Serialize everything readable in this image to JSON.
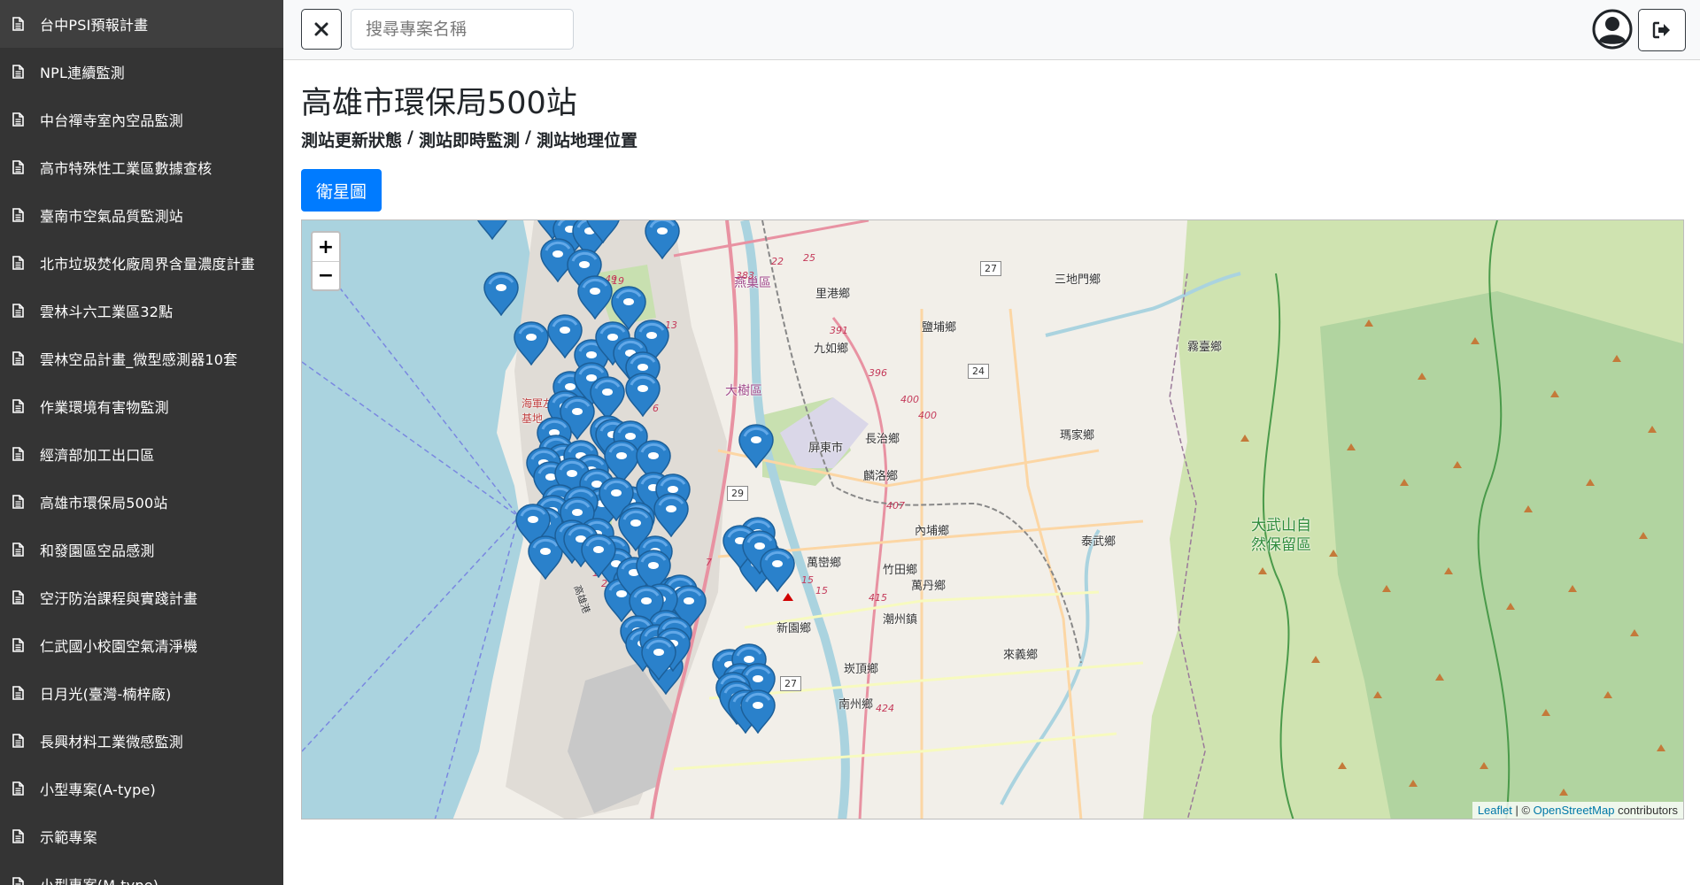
{
  "sidebar": {
    "items": [
      {
        "label": "台中PSI預報計畫"
      },
      {
        "label": "NPL連續監測"
      },
      {
        "label": "中台禪寺室內空品監測"
      },
      {
        "label": "高市特殊性工業區數據查核"
      },
      {
        "label": "臺南市空氣品質監測站"
      },
      {
        "label": "北市垃圾焚化廠周界含量濃度計畫"
      },
      {
        "label": "雲林斗六工業區32點"
      },
      {
        "label": "雲林空品計畫_微型感測器10套"
      },
      {
        "label": "作業環境有害物監測"
      },
      {
        "label": "經濟部加工出口區"
      },
      {
        "label": "高雄市環保局500站"
      },
      {
        "label": "和發園區空品感測"
      },
      {
        "label": "空汙防治課程與實踐計畫"
      },
      {
        "label": "仁武國小校園空氣清淨機"
      },
      {
        "label": "日月光(臺灣-楠梓廠)"
      },
      {
        "label": "長興材料工業微感監測"
      },
      {
        "label": "小型專案(A-type)"
      },
      {
        "label": "示範專案"
      },
      {
        "label": "小型專案(M-type)"
      }
    ]
  },
  "topbar": {
    "search_placeholder": "搜尋專案名稱",
    "close_icon": "times-icon",
    "user_icon": "user-circle-icon",
    "logout_icon": "sign-out-icon"
  },
  "main": {
    "title": "高雄市環保局500站",
    "breadcrumbs": [
      "測站更新狀態",
      "測站即時監測",
      "測站地理位置"
    ],
    "breadcrumb_separator": "/",
    "satellite_button": "衛星圖"
  },
  "map": {
    "zoom_in": "+",
    "zoom_out": "−",
    "attribution": {
      "leaflet": "Leaflet",
      "separator": " | © ",
      "osm": "OpenStreetMap",
      "suffix": " contributors"
    },
    "place_labels": {
      "yanchao": "燕巢區",
      "ligang": "里港鄉",
      "jiuru": "九如鄉",
      "yanpu": "鹽埔鄉",
      "sandimen": "三地門鄉",
      "wutai": "霧臺鄉",
      "dashu": "大樹區",
      "pingtung": "屏東市",
      "changzhi": "長治鄉",
      "majia": "瑪家鄉",
      "linluo": "麟洛鄉",
      "neipu": "內埔鄉",
      "taiwu": "泰武鄉",
      "wanluan": "萬巒鄉",
      "zhutian": "竹田鄉",
      "wandan": "萬丹鄉",
      "xinyuan": "新園鄉",
      "chaozhou": "潮州鎮",
      "laiyi": "來義鄉",
      "kanding": "崁頂鄉",
      "nanzhou": "南州鄉",
      "dawu_reserve_1": "大武山自",
      "dawu_reserve_2": "然保留區",
      "military_1": "海軍左",
      "military_2": "基地",
      "port": "高雄港"
    },
    "road_numbers": [
      "22",
      "25",
      "383",
      "19",
      "13",
      "391",
      "396",
      "400",
      "400",
      "407",
      "415",
      "424",
      "15",
      "15",
      "7",
      "6",
      "49",
      "3",
      "1",
      "2"
    ],
    "highway_shields": [
      "27",
      "24",
      "29",
      "27"
    ]
  }
}
